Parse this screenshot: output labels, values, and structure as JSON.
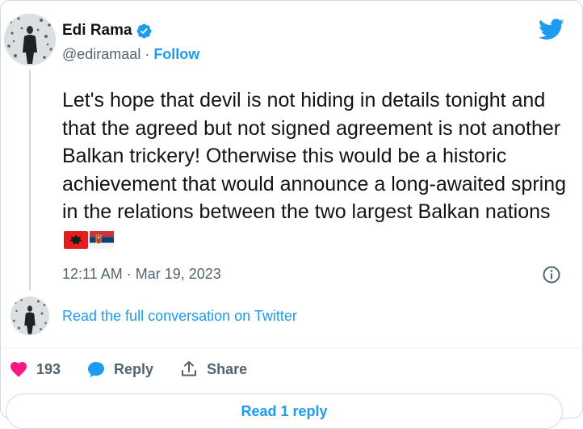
{
  "author": {
    "name": "Edi Rama",
    "handle": "@ediramaal",
    "separator": " · ",
    "follow_label": "Follow",
    "verified": true
  },
  "tweet": {
    "text": "Let's hope that devil is not hiding in details tonight and that the agreed but not signed agreement is not another Balkan trickery! Otherwise this would be a historic achievement that would announce a long-awaited spring in the relations between the two largest Balkan nations",
    "emojis": [
      "albania-flag",
      "serbia-flag"
    ],
    "timestamp": "12:11 AM · Mar 19, 2023"
  },
  "conversation": {
    "link_text": "Read the full conversation on Twitter"
  },
  "actions": {
    "like_count": "193",
    "reply_label": "Reply",
    "share_label": "Share"
  },
  "footer": {
    "read_replies_label": "Read 1 reply"
  },
  "colors": {
    "accent": "#1d9bf0",
    "like": "#f91880",
    "text": "#0f1419",
    "muted": "#536471",
    "border": "#cfd9de"
  },
  "icons": {
    "brand": "twitter-bird-icon",
    "verified": "verified-badge-icon",
    "info": "info-icon",
    "like": "heart-icon",
    "reply": "speech-bubble-icon",
    "share": "share-upload-icon"
  }
}
